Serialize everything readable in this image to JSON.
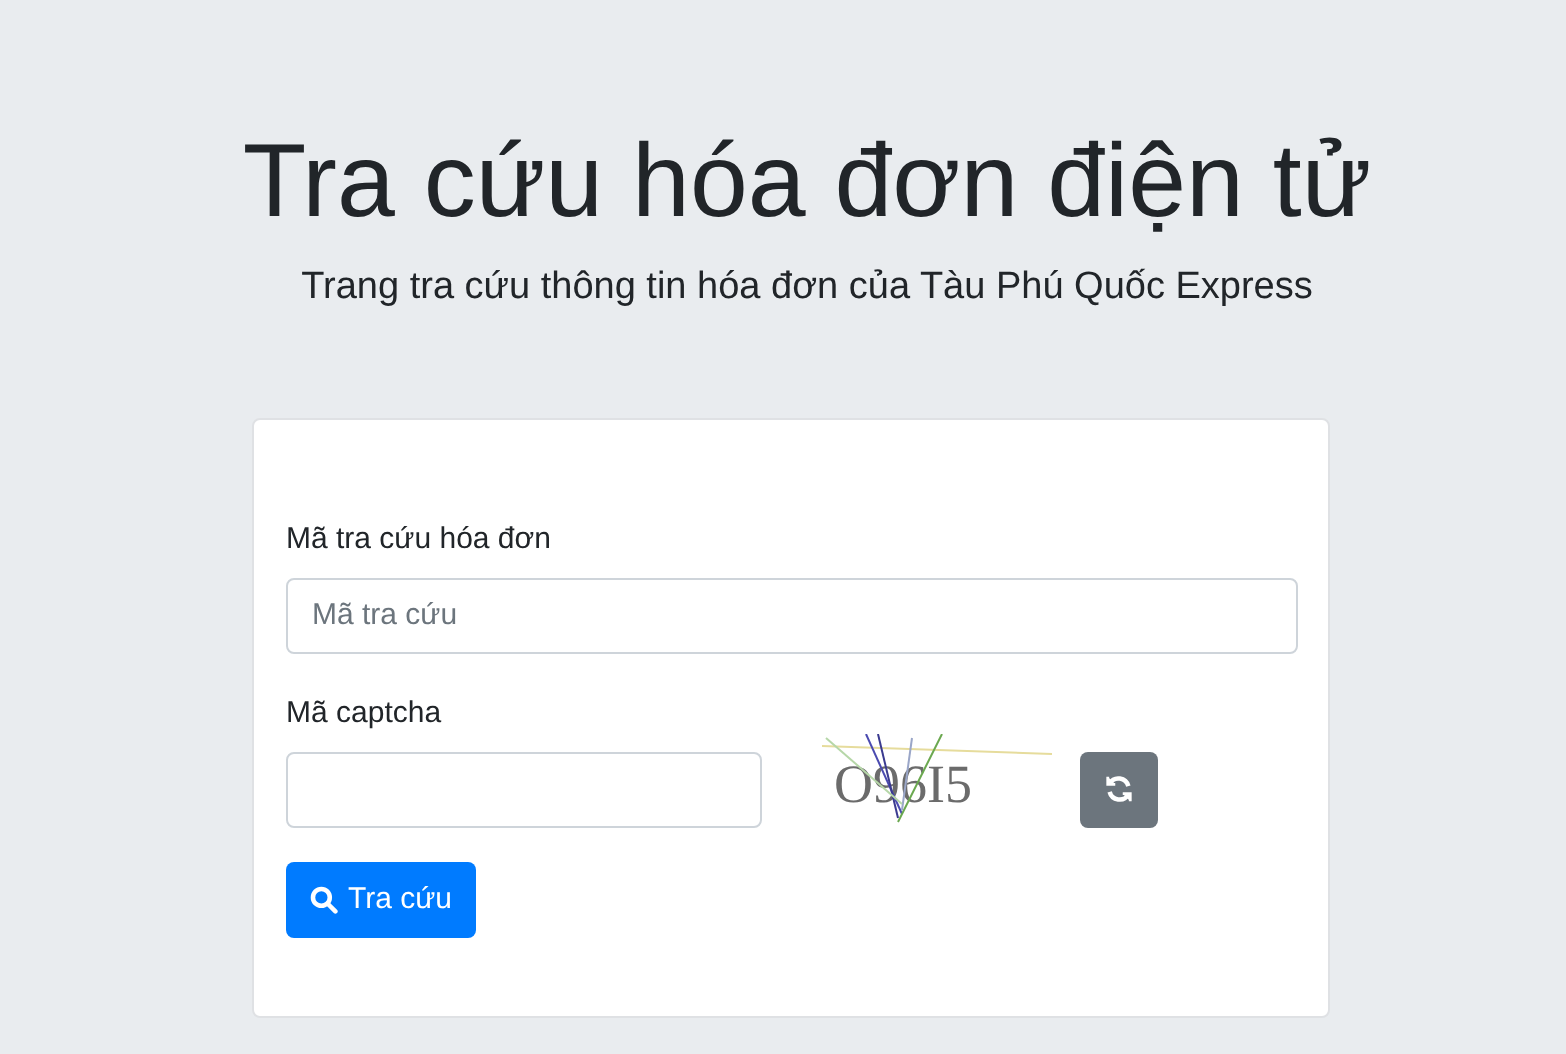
{
  "header": {
    "title": "Tra cứu hóa đơn điện tử",
    "subtitle": "Trang tra cứu thông tin hóa đơn của Tàu Phú Quốc Express"
  },
  "form": {
    "lookup_label": "Mã tra cứu hóa đơn",
    "lookup_placeholder": "Mã tra cứu",
    "captcha_label": "Mã captcha",
    "captcha_text": "O96I5",
    "submit_label": "Tra cứu"
  }
}
